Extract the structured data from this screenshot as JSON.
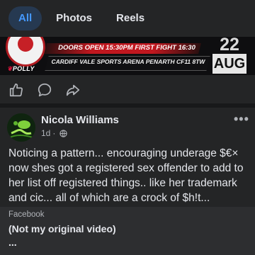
{
  "tabs": [
    {
      "label": "All",
      "active": true
    },
    {
      "label": "Photos",
      "active": false
    },
    {
      "label": "Reels",
      "active": false
    }
  ],
  "banner": {
    "doors_text": "DOORS OPEN 15:30PM  FIRST FIGHT 16:30",
    "venue_text": "CARDIFF VALE SPORTS ARENA PENARTH CF11 8TW",
    "sponsor": "POLLY",
    "date_day": "22",
    "date_month": "AUG"
  },
  "actions": [
    {
      "name": "like",
      "icon": "thumbs-up-icon"
    },
    {
      "name": "comment",
      "icon": "comment-icon"
    },
    {
      "name": "share",
      "icon": "share-icon"
    }
  ],
  "post": {
    "author": "Nicola Williams",
    "time": "1d",
    "more_label": "•••",
    "text": "Noticing a pattern... encouraging underage $€× now shes got a registered sex offender to add to her list off registered things..  like her trademark and cic... all of which are a crock of $h!t...",
    "shared": {
      "source": "Facebook",
      "title": "(Not my original video)",
      "more": "..."
    }
  },
  "colors": {
    "background": "#18191a",
    "card": "#242526",
    "accent": "#4599ff",
    "banner_red": "#c0171f"
  }
}
